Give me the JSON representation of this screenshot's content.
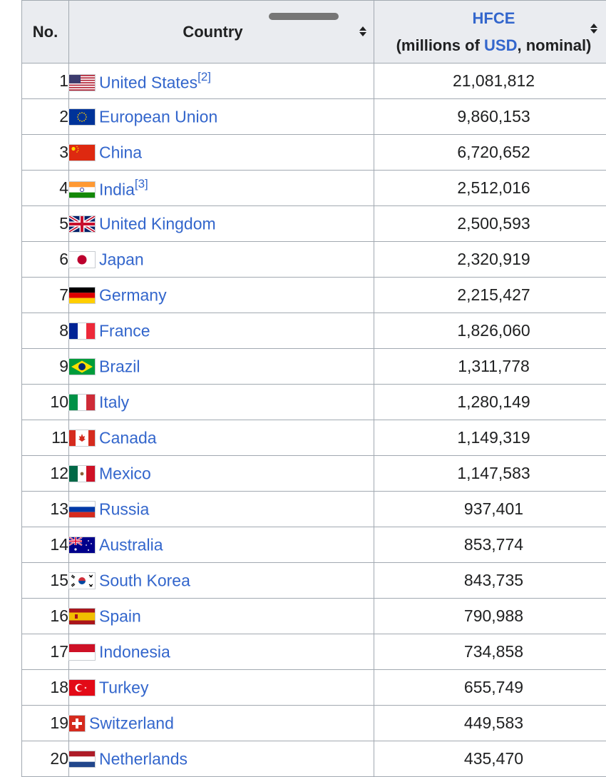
{
  "table": {
    "headers": {
      "no": "No.",
      "country": "Country",
      "hfce_link": "HFCE",
      "unit_open": "(millions of ",
      "usd_link": "USD",
      "unit_close": ", nominal)"
    },
    "rows": [
      {
        "no": "1",
        "country": "United States",
        "ref": "[2]",
        "flag": "us-flag-icon",
        "value": "21,081,812"
      },
      {
        "no": "2",
        "country": "European Union",
        "ref": "",
        "flag": "eu-flag-icon",
        "value": "9,860,153"
      },
      {
        "no": "3",
        "country": "China",
        "ref": "",
        "flag": "china-flag-icon",
        "value": "6,720,652"
      },
      {
        "no": "4",
        "country": "India",
        "ref": "[3]",
        "flag": "india-flag-icon",
        "value": "2,512,016"
      },
      {
        "no": "5",
        "country": "United Kingdom",
        "ref": "",
        "flag": "uk-flag-icon",
        "value": "2,500,593"
      },
      {
        "no": "6",
        "country": "Japan",
        "ref": "",
        "flag": "japan-flag-icon",
        "value": "2,320,919"
      },
      {
        "no": "7",
        "country": "Germany",
        "ref": "",
        "flag": "germany-flag-icon",
        "value": "2,215,427"
      },
      {
        "no": "8",
        "country": "France",
        "ref": "",
        "flag": "france-flag-icon",
        "value": "1,826,060"
      },
      {
        "no": "9",
        "country": "Brazil",
        "ref": "",
        "flag": "brazil-flag-icon",
        "value": "1,311,778"
      },
      {
        "no": "10",
        "country": "Italy",
        "ref": "",
        "flag": "italy-flag-icon",
        "value": "1,280,149"
      },
      {
        "no": "11",
        "country": "Canada",
        "ref": "",
        "flag": "canada-flag-icon",
        "value": "1,149,319"
      },
      {
        "no": "12",
        "country": "Mexico",
        "ref": "",
        "flag": "mexico-flag-icon",
        "value": "1,147,583"
      },
      {
        "no": "13",
        "country": "Russia",
        "ref": "",
        "flag": "russia-flag-icon",
        "value": "937,401"
      },
      {
        "no": "14",
        "country": "Australia",
        "ref": "",
        "flag": "australia-flag-icon",
        "value": "853,774"
      },
      {
        "no": "15",
        "country": "South Korea",
        "ref": "",
        "flag": "south-korea-flag-icon",
        "value": "843,735"
      },
      {
        "no": "16",
        "country": "Spain",
        "ref": "",
        "flag": "spain-flag-icon",
        "value": "790,988"
      },
      {
        "no": "17",
        "country": "Indonesia",
        "ref": "",
        "flag": "indonesia-flag-icon",
        "value": "734,858"
      },
      {
        "no": "18",
        "country": "Turkey",
        "ref": "",
        "flag": "turkey-flag-icon",
        "value": "655,749"
      },
      {
        "no": "19",
        "country": "Switzerland",
        "ref": "",
        "flag": "switzerland-flag-icon",
        "value": "449,583"
      },
      {
        "no": "20",
        "country": "Netherlands",
        "ref": "",
        "flag": "netherlands-flag-icon",
        "value": "435,470"
      }
    ]
  },
  "colors": {
    "link": "#3366cc",
    "header_bg": "#eaecf0",
    "border": "#a2a9b1",
    "text": "#202122"
  }
}
